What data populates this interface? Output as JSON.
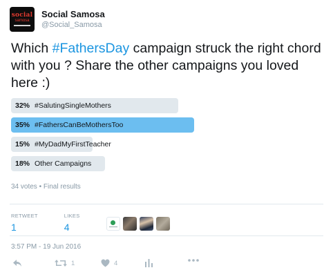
{
  "account": {
    "avatar_text_line1": "social",
    "avatar_text_line2": "samosa",
    "name": "Social Samosa",
    "handle": "@Social_Samosa"
  },
  "tweet": {
    "text_before": "Which ",
    "hashtag": "#FathersDay",
    "text_after": " campaign struck the right chord with you ? Share the other campaigns you loved here :)"
  },
  "poll": {
    "options": [
      {
        "percent": "32%",
        "label": "#SalutingSingleMothers",
        "value": 32,
        "winner": false
      },
      {
        "percent": "35%",
        "label": "#FathersCanBeMothersToo",
        "value": 35,
        "winner": true
      },
      {
        "percent": "15%",
        "label": "#MyDadMyFirstTeacher",
        "value": 15,
        "winner": false
      },
      {
        "percent": "18%",
        "label": "Other Campaigns",
        "value": 18,
        "winner": false
      }
    ],
    "votes": "34 votes",
    "separator": "•",
    "status": "Final results"
  },
  "stats": {
    "retweets_label": "RETWEET",
    "retweets_value": "1",
    "likes_label": "LIKES",
    "likes_value": "4"
  },
  "timestamp": "3:57 PM - 19 Jun 2016",
  "actions": {
    "retweet_count": "1",
    "like_count": "4"
  },
  "colors": {
    "link_blue": "#1b95e0",
    "poll_winner": "#6cbef0",
    "poll_bar": "#e1e8ed",
    "muted_gray": "#8899a6"
  },
  "icons": [
    "reply-icon",
    "retweet-icon",
    "like-icon",
    "analytics-icon",
    "more-icon"
  ]
}
